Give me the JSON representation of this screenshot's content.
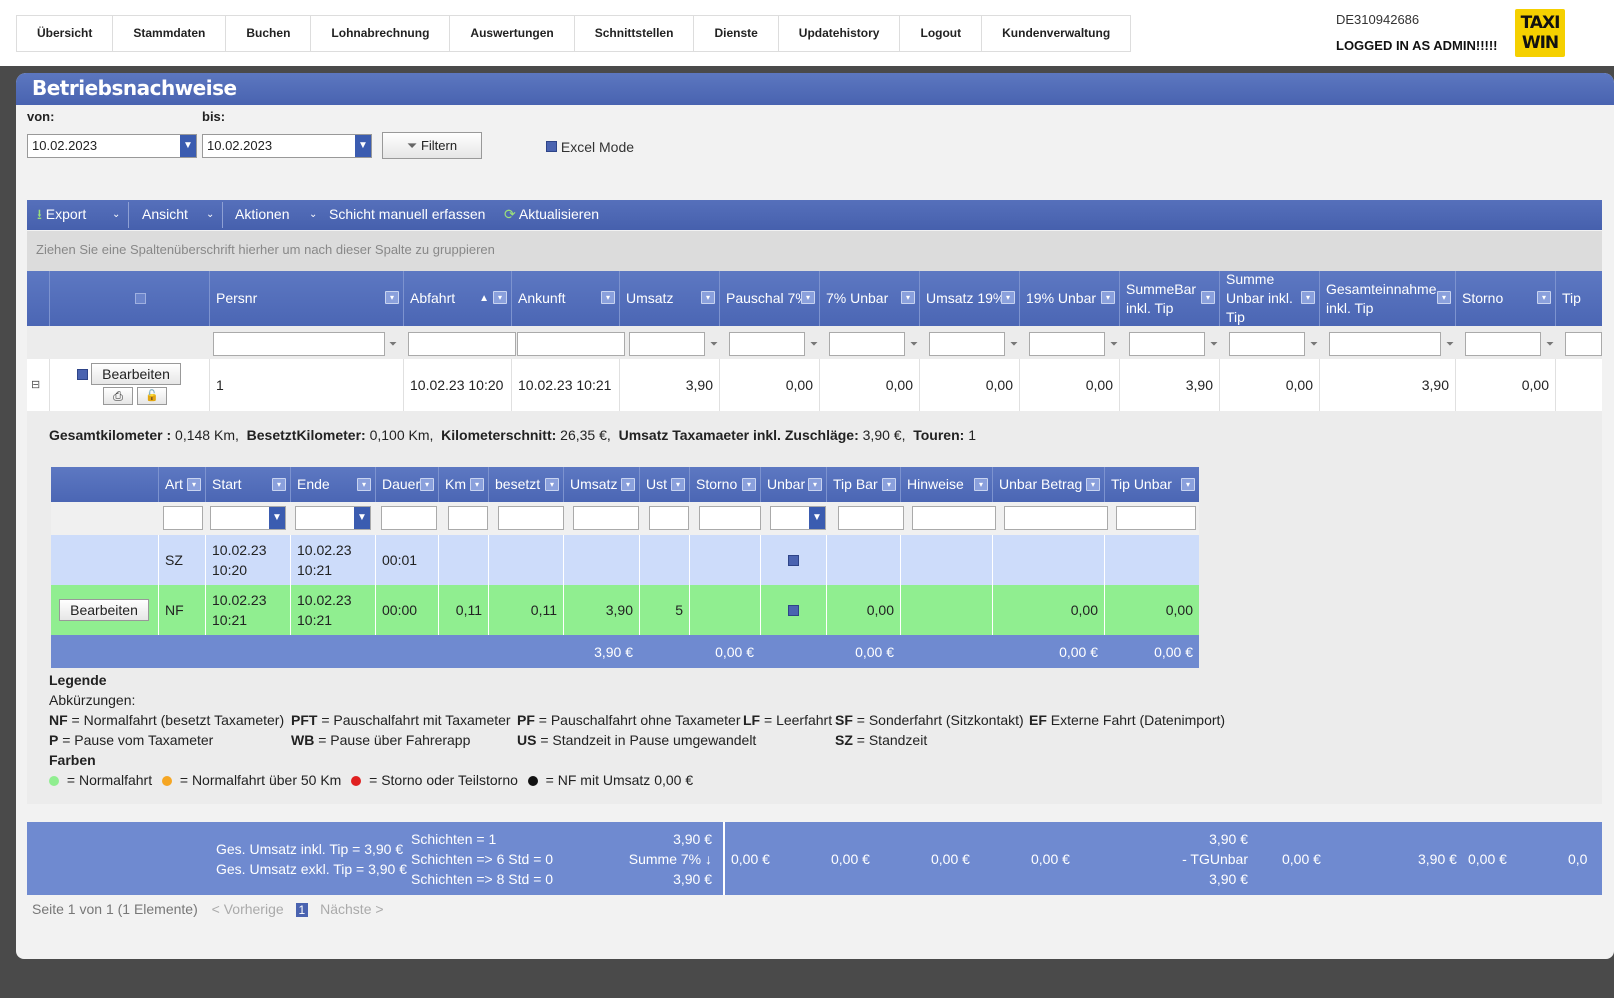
{
  "nav": [
    "Übersicht",
    "Stammdaten",
    "Buchen",
    "Lohnabrechnung",
    "Auswertungen",
    "Schnittstellen",
    "Dienste",
    "Updatehistory",
    "Logout",
    "Kundenverwaltung"
  ],
  "user": {
    "id": "DE310942686",
    "status": "LOGGED IN AS ADMIN!!!!!"
  },
  "logo": {
    "line1": "TAXI",
    "line2": "WIN",
    "color": "#f5d000"
  },
  "page": {
    "title": "Betriebsnachweise"
  },
  "dates": {
    "from_label": "von:",
    "from": "10.02.2023",
    "to_label": "bis:",
    "to": "10.02.2023"
  },
  "filter_button": "Filtern",
  "excel_mode": "Excel Mode",
  "toolbar": {
    "export": "Export",
    "ansicht": "Ansicht",
    "aktionen": "Aktionen",
    "schicht": "Schicht manuell erfassen",
    "aktualisieren": "Aktualisieren"
  },
  "group_hint": "Ziehen Sie eine Spaltenüberschrift hierher um nach dieser Spalte zu gruppieren",
  "columns": [
    "Persnr",
    "Abfahrt",
    "Ankunft",
    "Umsatz",
    "Pauschal 7%",
    "7% Unbar",
    "Umsatz 19%",
    "19% Unbar",
    "SummeBar inkl. Tip",
    "Summe Unbar inkl. Tip",
    "Gesamteinnahme inkl. Tip",
    "Storno",
    "Tip"
  ],
  "sort_indicator": "▲",
  "row": {
    "edit": "Bearbeiten",
    "persnr": "1",
    "abfahrt": "10.02.23 10:20",
    "ankunft": "10.02.23 10:21",
    "umsatz": "3,90",
    "pauschal7": "0,00",
    "unbar7": "0,00",
    "umsatz19": "0,00",
    "unbar19": "0,00",
    "summebar": "3,90",
    "summeunbar": "0,00",
    "gesamt": "3,90",
    "storno": "0,00"
  },
  "detail_summary": {
    "km_label": "Gesamtkilometer :",
    "km": " 0,148 Km,",
    "besetzt_label": "BesetztKilometer:",
    "besetzt": " 0,100 Km,",
    "schnitt_label": "Kilometerschnitt:",
    "schnitt": " 26,35 €,",
    "umsatz_label": "Umsatz Taxamaeter inkl. Zuschläge:",
    "umsatz": " 3,90 €,",
    "touren_label": "Touren:",
    "touren": " 1"
  },
  "sub_columns": [
    "Art",
    "Start",
    "Ende",
    "Dauer",
    "Km",
    "besetzt",
    "Umsatz",
    "Ust",
    "Storno",
    "Unbar",
    "Tip Bar",
    "Hinweise",
    "Unbar Betrag",
    "Tip Unbar"
  ],
  "sub_rows": [
    {
      "art": "SZ",
      "start1": "10.02.23",
      "start2": "10:20",
      "ende1": "10.02.23",
      "ende2": "10:21",
      "dauer": "00:01",
      "km": "",
      "besetzt": "",
      "umsatz": "",
      "ust": "",
      "storno": "",
      "tipbar": "",
      "hinweise": "",
      "unbarbetrag": "",
      "tipunbar": "",
      "color": "#cddcfa"
    },
    {
      "edit": "Bearbeiten",
      "art": "NF",
      "start1": "10.02.23",
      "start2": "10:21",
      "ende1": "10.02.23",
      "ende2": "10:21",
      "dauer": "00:00",
      "km": "0,11",
      "besetzt": "0,11",
      "umsatz": "3,90",
      "ust": "5",
      "storno": "",
      "tipbar": "0,00",
      "hinweise": "",
      "unbarbetrag": "0,00",
      "tipunbar": "0,00",
      "color": "#90ee90"
    }
  ],
  "sub_totals": {
    "umsatz": "3,90 €",
    "storno": "0,00 €",
    "tipbar": "0,00 €",
    "unbarbetrag": "0,00 €",
    "tipunbar": "0,00 €"
  },
  "legend": {
    "title": "Legende",
    "abbr_title": "Abkürzungen:",
    "nf": "NF",
    "nf_t": " = Normalfahrt (besetzt Taxameter)",
    "pft": "PFT",
    "pft_t": " = Pauschalfahrt mit Taxameter",
    "pf": "PF",
    "pf_t": " = Pauschalfahrt ohne Taxameter",
    "lf": "LF",
    "lf_t": " = Leerfahrt",
    "sf": "SF",
    "sf_t": " = Sonderfahrt (Sitzkontakt)",
    "ef": "EF",
    "ef_t": " Externe Fahrt (Datenimport)",
    "p": "P",
    "p_t": " = Pause vom Taxameter",
    "wb": "WB",
    "wb_t": " = Pause über Fahrerapp",
    "us": "US",
    "us_t": " = Standzeit in Pause umgewandelt",
    "sz": "SZ",
    "sz_t": " = Standzeit",
    "colors_title": "Farben",
    "c1": " = Normalfahrt",
    "c2": " = Normalfahrt über 50 Km",
    "c3": " = Storno oder Teilstorno",
    "c4": " = NF mit Umsatz 0,00 €",
    "c1_color": "#90ee90",
    "c2_color": "#f5a623",
    "c3_color": "#e02020",
    "c4_color": "#111111"
  },
  "footer": {
    "ges_inkl": "Ges. Umsatz inkl. Tip = 3,90 €",
    "ges_exkl": "Ges. Umsatz exkl. Tip = 3,90 €",
    "schichten": "Schichten = 1",
    "schichten6": "Schichten => 6 Std = 0",
    "schichten8": "Schichten => 8 Std = 0",
    "umsatz1": "3,90 €",
    "summe7": "Summe 7% ↓",
    "umsatz2": "3,90 €",
    "p7": "0,00 €",
    "u7": "0,00 €",
    "u19": "0,00 €",
    "un19": "0,00 €",
    "sb1": "3,90 €",
    "sb2": "- TGUnbar",
    "sb3": "3,90 €",
    "su": "0,00 €",
    "ge": "3,90 €",
    "st": "0,00 €",
    "tip": "0,0"
  },
  "pager": {
    "info": "Seite 1 von 1 (1 Elemente)",
    "prev": "< Vorherige",
    "page": "1",
    "next": "Nächste >"
  }
}
